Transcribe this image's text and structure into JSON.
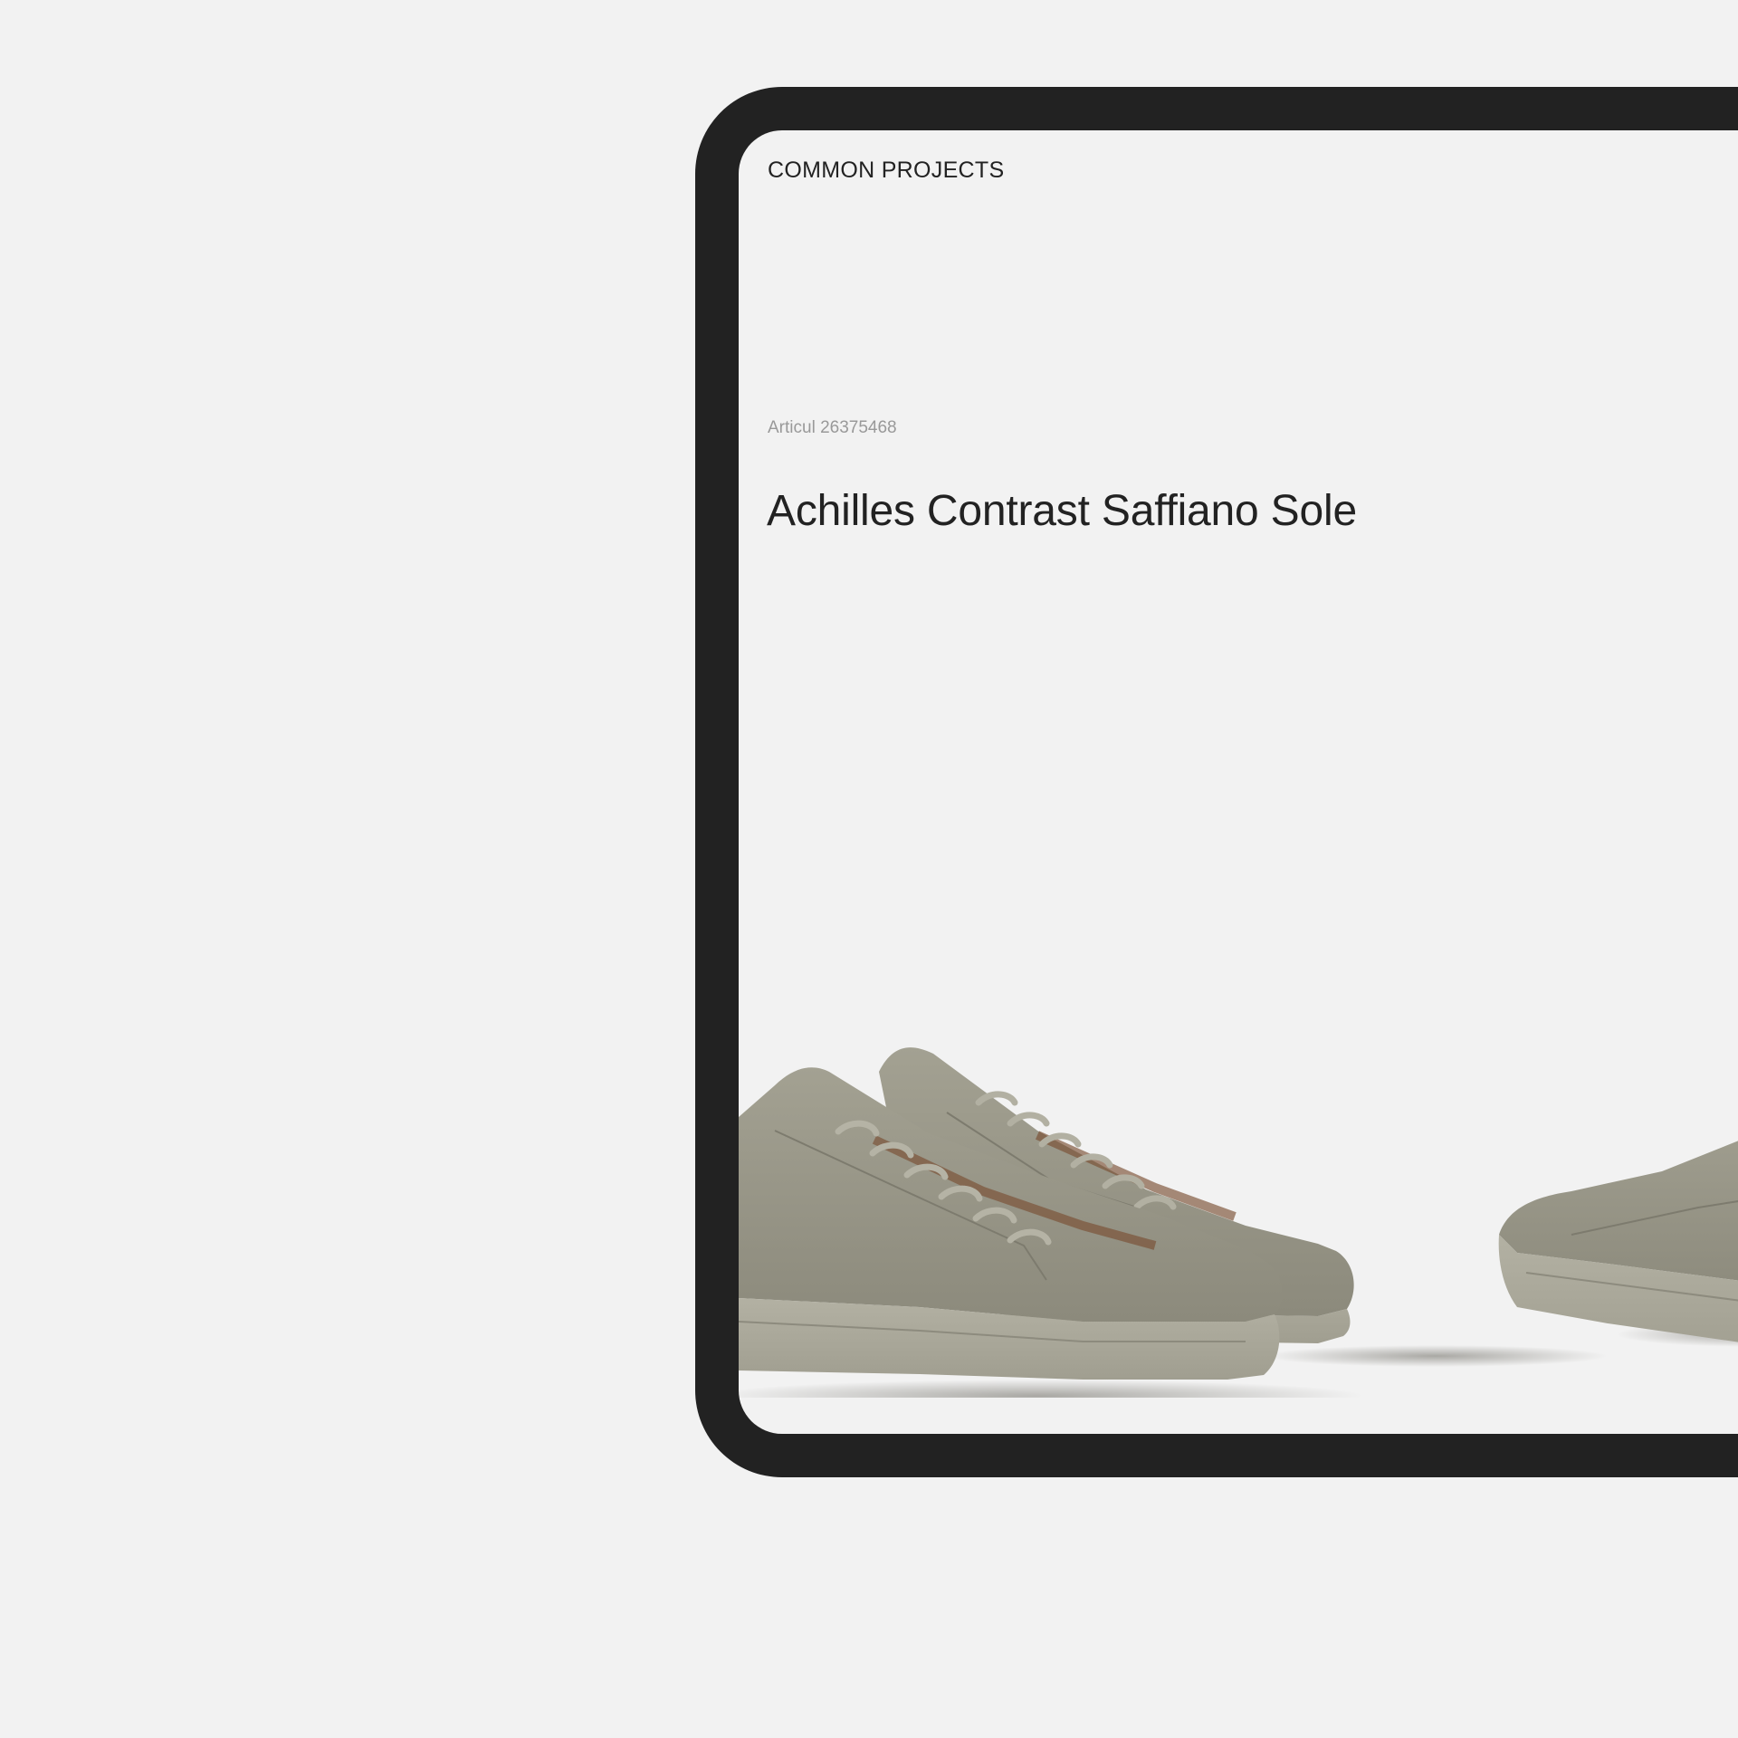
{
  "header": {
    "brand": "COMMON PROJECTS"
  },
  "product": {
    "article_label": "Articul 26375468",
    "name": "Achilles Contrast Saffiano Sole",
    "image": {
      "icon": "sneaker-pair-image",
      "color": "#9c9a8c"
    }
  },
  "colors": {
    "background": "#f2f2f2",
    "device_frame": "#222222",
    "text_primary": "#222222",
    "text_secondary": "#999999"
  }
}
